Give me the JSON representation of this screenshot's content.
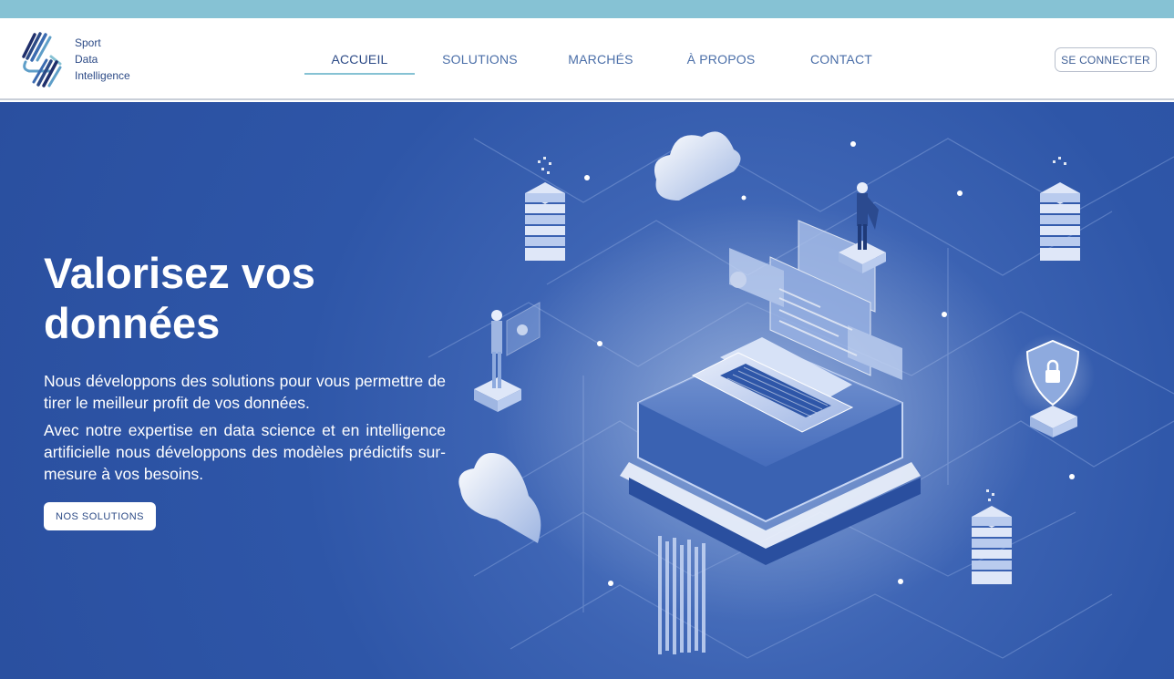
{
  "brand": {
    "line1": "Sport",
    "line2": "Data",
    "line3": "Intelligence"
  },
  "nav": {
    "items": [
      {
        "label": "ACCUEIL",
        "active": true
      },
      {
        "label": "SOLUTIONS",
        "active": false
      },
      {
        "label": "MARCHÉS",
        "active": false
      },
      {
        "label": "À PROPOS",
        "active": false
      },
      {
        "label": "CONTACT",
        "active": false
      }
    ],
    "login_label": "SE CONNECTER"
  },
  "hero": {
    "title": "Valorisez vos données",
    "paragraph1": "Nous développons des solutions pour vous permettre de tirer le meilleur profit de vos données.",
    "paragraph2": "Avec notre expertise en data science et en intelligence artificielle nous développons des modèles prédictifs sur-mesure à vos besoins.",
    "cta_label": "NOS SOLUTIONS"
  },
  "colors": {
    "accent_strip": "#86c2d4",
    "hero_bg": "#2e56a8",
    "nav_text": "#4a6ea8",
    "brand_text": "#2c4a86"
  },
  "icons": [
    "logo-mark-icon",
    "cloud-icon",
    "server-stack-icon",
    "laptop-icon",
    "shield-lock-icon",
    "person-icon"
  ]
}
